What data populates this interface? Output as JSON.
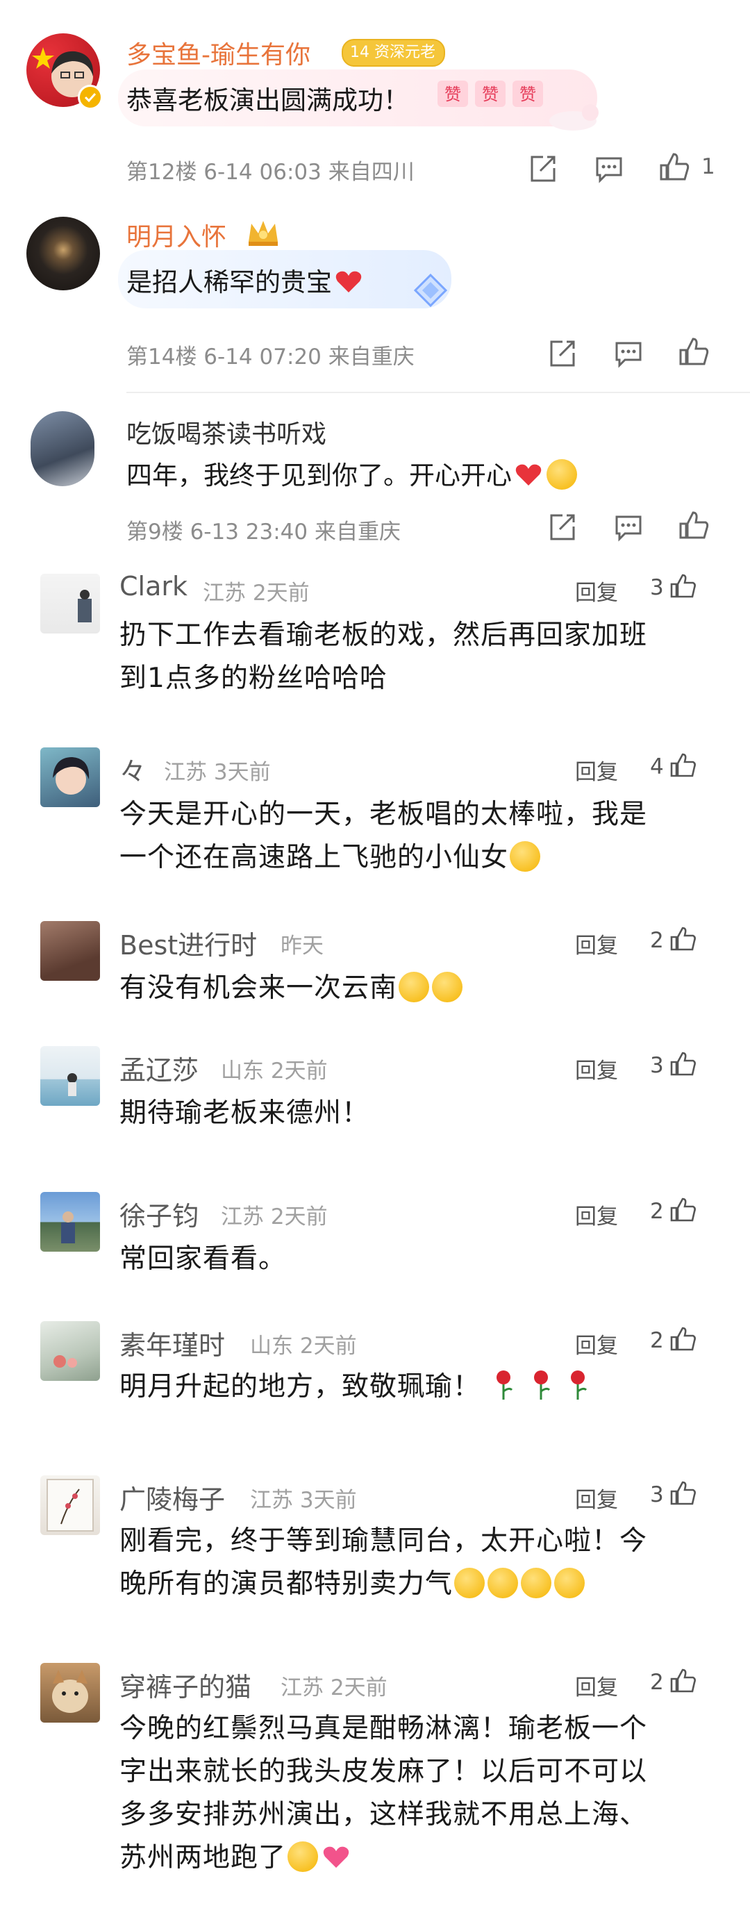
{
  "top_comments": [
    {
      "name": "多宝鱼-瑜生有你",
      "badge": "资深元老",
      "badge_level": "14",
      "text": "恭喜老板演出圆满成功！",
      "meta": "第12楼 6-14 06:03 来自四川",
      "likes": "1"
    },
    {
      "name": "明月入怀",
      "text": "是招人稀罕的贵宝",
      "meta": "第14楼 6-14 07:20 来自重庆"
    },
    {
      "name": "吃饭喝茶读书听戏",
      "text": "四年，我终于见到你了。开心开心",
      "meta": "第9楼 6-13 23:40 来自重庆"
    }
  ],
  "reply_label": "回复",
  "replies": [
    {
      "name": "Clark",
      "meta": "江苏 2天前",
      "likes": "3",
      "lines": [
        "扔下工作去看瑜老板的戏，然后再回家加班",
        "到1点多的粉丝哈哈哈"
      ]
    },
    {
      "name": "々",
      "meta": "江苏 3天前",
      "likes": "4",
      "lines": [
        "今天是开心的一天，老板唱的太棒啦，我是",
        "一个还在高速路上飞驰的小仙女"
      ]
    },
    {
      "name": "Best进行时",
      "meta": "昨天",
      "likes": "2",
      "lines": [
        "有没有机会来一次云南"
      ]
    },
    {
      "name": "孟辽莎",
      "meta": "山东 2天前",
      "likes": "3",
      "lines": [
        "期待瑜老板来德州！"
      ]
    },
    {
      "name": "徐子钧",
      "meta": "江苏 2天前",
      "likes": "2",
      "lines": [
        "常回家看看。"
      ]
    },
    {
      "name": "素年瑾时",
      "meta": "山东 2天前",
      "likes": "2",
      "lines": [
        "明月升起的地方，致敬珮瑜！"
      ]
    },
    {
      "name": "广陵梅子",
      "meta": "江苏 3天前",
      "likes": "3",
      "lines": [
        "刚看完，终于等到瑜慧同台，太开心啦！今",
        "晚所有的演员都特别卖力气"
      ]
    },
    {
      "name": "穿裤子的猫",
      "meta": "江苏 2天前",
      "likes": "2",
      "lines": [
        "今晚的红鬃烈马真是酣畅淋漓！瑜老板一个",
        "字出来就长的我头皮发麻了！以后可不可以",
        "多多安排苏州演出，这样我就不用总上海、",
        "苏州两地跑了"
      ]
    }
  ],
  "colors": {
    "name_orange": "#e8743b",
    "meta_gray": "#8c8c8c",
    "heart_red": "#e8333b"
  },
  "icons": [
    "share-icon",
    "comment-icon",
    "like-icon",
    "thumb-up-icon",
    "heart-emoji",
    "smile-emoji",
    "rose-emoji"
  ]
}
